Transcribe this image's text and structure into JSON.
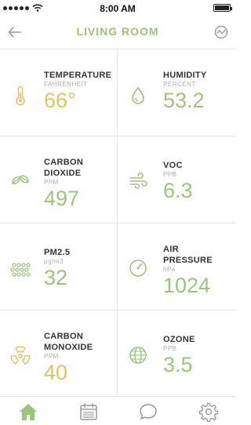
{
  "status_bar": {
    "time": "8:00 AM"
  },
  "header": {
    "title": "LIVING ROOM"
  },
  "colors": {
    "green": "#9cc57a",
    "yellow": "#e3c263"
  },
  "metrics": [
    {
      "label": "TEMPERATURE",
      "label2": "",
      "unit": "FAHRENHEIT",
      "value": "66°",
      "status": "yellow",
      "icon": "thermometer-icon"
    },
    {
      "label": "HUMIDITY",
      "label2": "",
      "unit": "PERCENT",
      "value": "53.2",
      "status": "green",
      "icon": "water-drop-icon"
    },
    {
      "label": "CARBON",
      "label2": "DIOXIDE",
      "unit": "PPM",
      "value": "497",
      "status": "green",
      "icon": "leaf-icon"
    },
    {
      "label": "VOC",
      "label2": "",
      "unit": "PPB",
      "value": "6.3",
      "status": "green",
      "icon": "wind-icon"
    },
    {
      "label": "PM2.5",
      "label2": "",
      "unit": "μg/m3",
      "value": "32",
      "status": "green",
      "icon": "particles-icon"
    },
    {
      "label": "AIR",
      "label2": "PRESSURE",
      "unit": "hPa",
      "value": "1024",
      "status": "green",
      "icon": "gauge-icon"
    },
    {
      "label": "CARBON",
      "label2": "MONOXIDE",
      "unit": "PPM",
      "value": "40",
      "status": "yellow",
      "icon": "radiation-icon"
    },
    {
      "label": "OZONE",
      "label2": "",
      "unit": "PPB",
      "value": "3.5",
      "status": "green",
      "icon": "globe-icon"
    }
  ],
  "tabs": [
    {
      "name": "home-icon",
      "active": true
    },
    {
      "name": "calendar-icon",
      "active": false
    },
    {
      "name": "chat-icon",
      "active": false
    },
    {
      "name": "gear-icon",
      "active": false
    }
  ]
}
